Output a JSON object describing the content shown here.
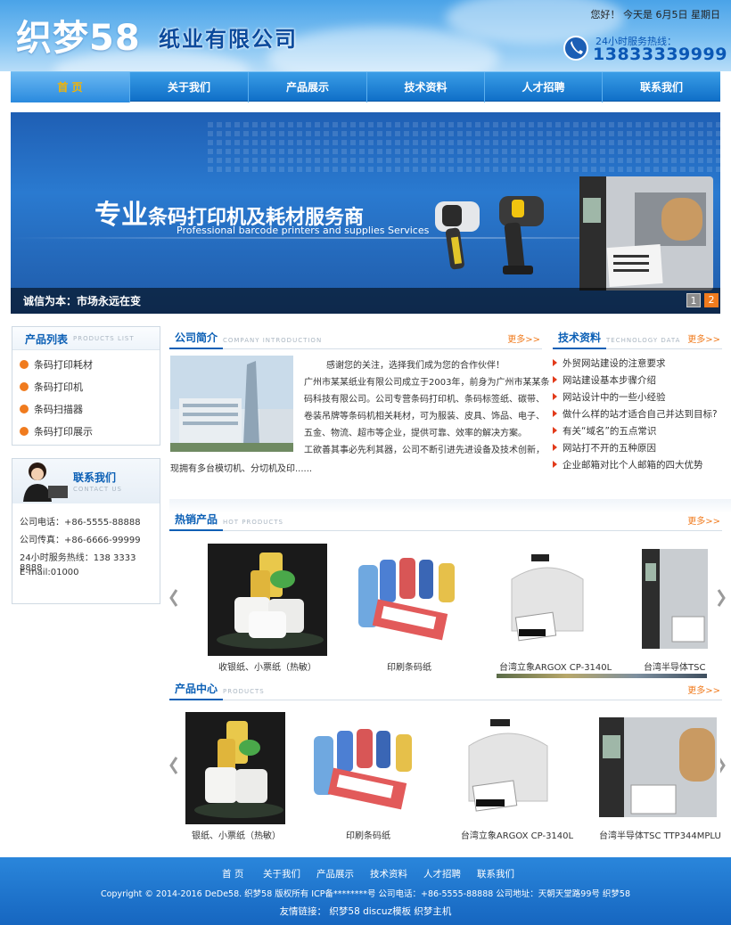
{
  "header": {
    "logo_main": "织梦58",
    "logo_sub": "纸业有限公司",
    "greeting": "您好！  今天是  6月5日  星期日",
    "hotline_label": "24小时服务热线：",
    "hotline_number": "13833339999"
  },
  "nav": {
    "items": [
      {
        "label": "首 页",
        "active": true
      },
      {
        "label": "关于我们"
      },
      {
        "label": "产品展示"
      },
      {
        "label": "技术资料"
      },
      {
        "label": "人才招聘"
      },
      {
        "label": "联系我们"
      }
    ]
  },
  "banner": {
    "title_big": "专业",
    "title_rest": "条码打印机及耗材服务商",
    "subtitle": "Professional barcode printers and supplies Services",
    "caption": "诚信为本：市场永远在变",
    "pages": [
      "1",
      "2"
    ],
    "active_page": "2"
  },
  "sidebar": {
    "products": {
      "title": "产品列表",
      "title_en": "PRODUCTS LIST",
      "items": [
        "条码打印耗材",
        "条码打印机",
        "条码扫描器",
        "条码打印展示"
      ]
    },
    "contact": {
      "title": "联系我们",
      "title_en": "CONTACT US",
      "phone": "公司电话：+86-5555-88888",
      "fax": "公司传真：+86-6666-99999",
      "hotline": "24小时服务热线：138 3333 8888",
      "email": "E-mail:01000"
    }
  },
  "intro": {
    "title": "公司简介",
    "title_en": "COMPANY INTRODUCTION",
    "more": "更多>>",
    "greeting_line": "感谢您的关注，选择我们成为您的合作伙伴！",
    "lines": [
      "广州市某某纸业有限公司成立于2003年，前身为广州市某某条",
      "码科技有限公司。公司专营条码打印机、条码标签纸、碳带、",
      "卷装吊牌等条码机相关耗材，可为服装、皮具、饰品、电子、",
      "五金、物流、超市等企业，提供可靠、效率的解决方案。",
      "工欲善其事必先利其器，公司不断引进先进设备及技术创新，"
    ],
    "last_line": "现拥有多台模切机、分切机及印......"
  },
  "tech": {
    "title": "技术资料",
    "title_en": "TECHNOLOGY DATA",
    "more": "更多>>",
    "items": [
      "外贸网站建设的注意要求",
      "网站建设基本步骤介绍",
      "网站设计中的一些小经验",
      "做什么样的站才适合自己并达到目标?",
      "有关“域名”的五点常识",
      "网站打不开的五种原因",
      "企业邮箱对比个人邮箱的四大优势"
    ]
  },
  "hot": {
    "title": "热销产品",
    "title_en": "HOT PRODUCTS",
    "more": "更多>>",
    "items": [
      "收银纸、小票纸（热敏）",
      "印刷条码纸",
      "台湾立象ARGOX CP-3140L",
      "台湾半导体TSC"
    ]
  },
  "center": {
    "title": "产品中心",
    "title_en": "PRODUCTS",
    "more": "更多>>",
    "items": [
      "银纸、小票纸（热敏）",
      "印刷条码纸",
      "台湾立象ARGOX CP-3140L",
      "台湾半导体TSC TTP344MPLU"
    ]
  },
  "footer": {
    "links": [
      "首 页",
      "关于我们",
      "产品展示",
      "技术资料",
      "人才招聘",
      "联系我们"
    ],
    "copyright": "Copyright © 2014-2016 DeDe58. 织梦58 版权所有  ICP备********号  公司电话：+86-5555-88888  公司地址：天朝天堂路99号  织梦58",
    "friend_links": "友情链接：  织梦58  discuz模板  织梦主机"
  },
  "colors": {
    "brand_blue": "#0b5fb5",
    "accent_orange": "#f07b1e"
  }
}
